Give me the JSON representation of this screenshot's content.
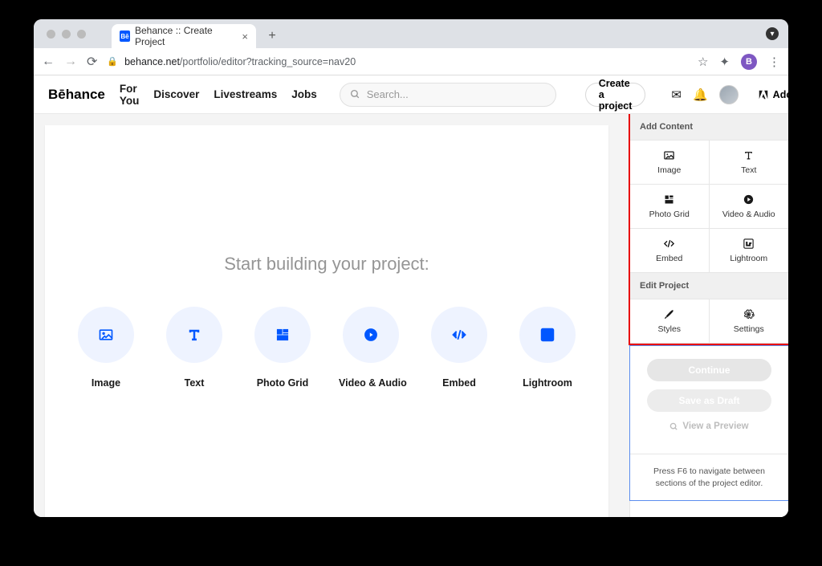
{
  "browser": {
    "tab_title": "Behance :: Create Project",
    "url_host": "behance.net",
    "url_path": "/portfolio/editor?tracking_source=nav20",
    "profile_initial": "B"
  },
  "header": {
    "logo": "Bēhance",
    "nav": [
      "For You",
      "Discover",
      "Livestreams",
      "Jobs"
    ],
    "search_placeholder": "Search...",
    "cta": "Create a project",
    "adobe": "Adobe"
  },
  "canvas": {
    "heading": "Start building your project:",
    "tiles": [
      {
        "label": "Image",
        "icon": "image"
      },
      {
        "label": "Text",
        "icon": "text"
      },
      {
        "label": "Photo Grid",
        "icon": "grid"
      },
      {
        "label": "Video & Audio",
        "icon": "play"
      },
      {
        "label": "Embed",
        "icon": "code"
      },
      {
        "label": "Lightroom",
        "icon": "lr"
      }
    ]
  },
  "rail": {
    "section_add": "Add Content",
    "add_items": [
      {
        "label": "Image",
        "icon": "image"
      },
      {
        "label": "Text",
        "icon": "text"
      },
      {
        "label": "Photo Grid",
        "icon": "grid"
      },
      {
        "label": "Video & Audio",
        "icon": "play"
      },
      {
        "label": "Embed",
        "icon": "code"
      },
      {
        "label": "Lightroom",
        "icon": "lr"
      }
    ],
    "section_edit": "Edit Project",
    "edit_items": [
      {
        "label": "Styles",
        "icon": "brush"
      },
      {
        "label": "Settings",
        "icon": "gear"
      }
    ],
    "continue": "Continue",
    "draft": "Save as Draft",
    "preview": "View a Preview",
    "hint": "Press F6 to navigate between sections of the project editor."
  }
}
